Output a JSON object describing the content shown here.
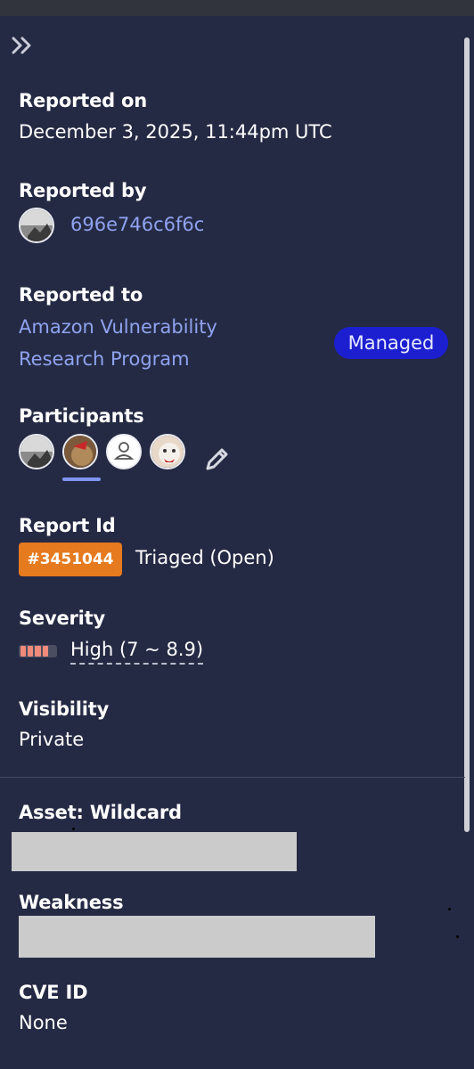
{
  "sidebar": {
    "reported_on": {
      "label": "Reported on",
      "value": "December 3, 2025, 11:44pm UTC"
    },
    "reported_by": {
      "label": "Reported by",
      "username": "696e746c6f6c"
    },
    "reported_to": {
      "label": "Reported to",
      "program_line1": "Amazon Vulnerability",
      "program_line2": "Research Program",
      "badge": "Managed"
    },
    "participants": {
      "label": "Participants"
    },
    "report_id": {
      "label": "Report Id",
      "id": "#3451044",
      "status": "Triaged (Open)"
    },
    "severity": {
      "label": "Severity",
      "value": "High (7 ~ 8.9)",
      "level_fraction": 0.8
    },
    "visibility": {
      "label": "Visibility",
      "value": "Private"
    },
    "asset": {
      "label": "Asset: Wildcard"
    },
    "weakness": {
      "label": "Weakness"
    },
    "cve": {
      "label": "CVE ID",
      "value": "None"
    }
  },
  "colors": {
    "background": "#252a44",
    "link": "#8fa3f0",
    "managed_badge": "#1c1fd0",
    "report_badge": "#e57a1f",
    "severity_high": "#f08a7a"
  },
  "icons": [
    "collapse-sidebar-icon",
    "user-placeholder-icon",
    "pencil-edit-icon"
  ]
}
